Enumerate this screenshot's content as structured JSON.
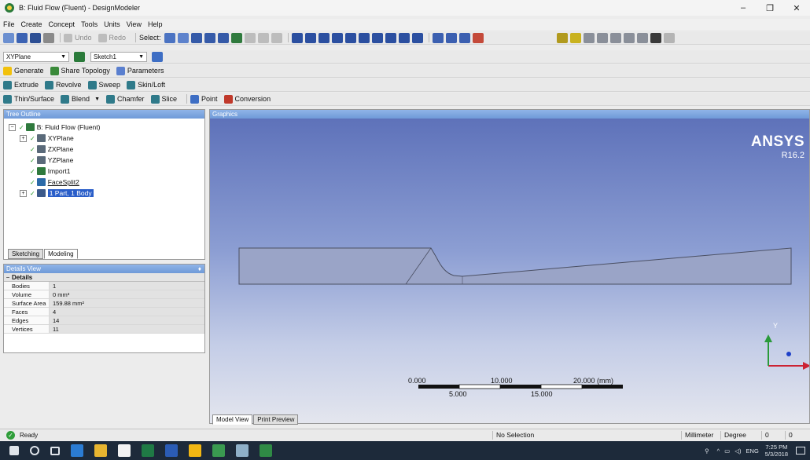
{
  "window": {
    "title": "B: Fluid Flow (Fluent) - DesignModeler",
    "minimize": "–",
    "restore": "❐",
    "close": "✕"
  },
  "menu": [
    "File",
    "Create",
    "Concept",
    "Tools",
    "Units",
    "View",
    "Help"
  ],
  "toolbar1": {
    "undo": "Undo",
    "redo": "Redo",
    "select_label": "Select:"
  },
  "toolbar2": {
    "plane_value": "XYPlane",
    "sketch_value": "Sketch1"
  },
  "toolbar3": {
    "generate": "Generate",
    "share_topology": "Share Topology",
    "parameters": "Parameters"
  },
  "toolbar4": {
    "extrude": "Extrude",
    "revolve": "Revolve",
    "sweep": "Sweep",
    "skin_loft": "Skin/Loft"
  },
  "toolbar5": {
    "thin_surface": "Thin/Surface",
    "blend": "Blend",
    "chamfer": "Chamfer",
    "slice": "Slice",
    "point": "Point",
    "conversion": "Conversion"
  },
  "tree": {
    "header": "Tree Outline",
    "root": "B: Fluid Flow (Fluent)",
    "items": [
      "XYPlane",
      "ZXPlane",
      "YZPlane",
      "Import1",
      "FaceSplit2",
      "1 Part, 1 Body"
    ]
  },
  "left_tabs": [
    "Sketching",
    "Modeling"
  ],
  "details": {
    "header": "Details View",
    "pin": "♦",
    "section": "Details",
    "rows": [
      {
        "key": "Bodies",
        "value": "1"
      },
      {
        "key": "Volume",
        "value": "0 mm³"
      },
      {
        "key": "Surface Area",
        "value": "159.88 mm²"
      },
      {
        "key": "Faces",
        "value": "4"
      },
      {
        "key": "Edges",
        "value": "14"
      },
      {
        "key": "Vertices",
        "value": "11"
      }
    ]
  },
  "graphics": {
    "header": "Graphics",
    "brand": "ANSYS",
    "version": "R16.2",
    "scale_top": [
      "0.000",
      "10.000",
      "20.000 (mm)"
    ],
    "scale_bottom": [
      "5.000",
      "15.000"
    ],
    "axis_y": "Y"
  },
  "graphics_tabs": [
    "Model View",
    "Print Preview"
  ],
  "status": {
    "ready": "Ready",
    "selection": "No Selection",
    "units": "Millimeter",
    "angle": "Degree",
    "v1": "0",
    "v2": "0"
  },
  "taskbar": {
    "lang": "ENG",
    "time": "7:25 PM",
    "date": "5/3/2018"
  },
  "colors": {
    "graphics_top": "#5b6fb8",
    "body_fill": "#9aa4c7",
    "selection_blue": "#2a5ec9",
    "axis_red": "#cc2233",
    "axis_green": "#2a9a3a",
    "axis_blue": "#1e40c8"
  }
}
